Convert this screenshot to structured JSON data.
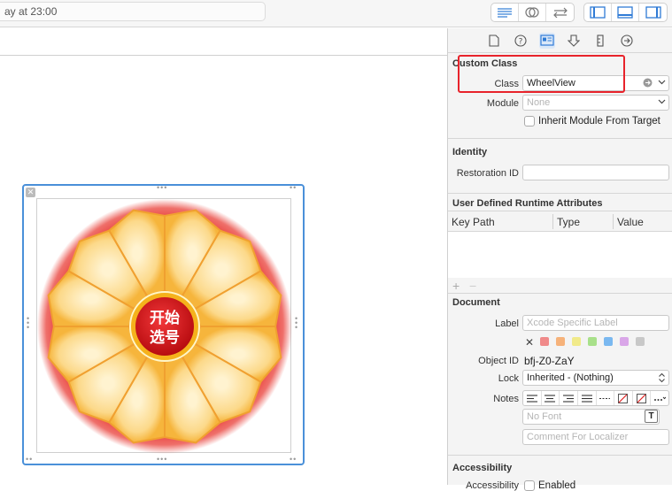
{
  "toolbar": {
    "status_text": "ay at 23:00",
    "editor_buttons": [
      "standard-editor-icon",
      "assistant-editor-icon",
      "version-editor-icon"
    ],
    "view_buttons": [
      "navigator-toggle-icon",
      "debug-area-toggle-icon",
      "utilities-toggle-icon"
    ]
  },
  "canvas": {
    "view_name": "WheelView",
    "center_button": {
      "line1": "开始",
      "line2": "选号"
    },
    "colors": {
      "selection": "#4a90d9",
      "wheel_outer": "#e8322b",
      "wheel_petal": "#fcd98a",
      "center_red": "#d8141a",
      "center_ring": "#f5b21c"
    }
  },
  "inspector": {
    "tabs": [
      "file-icon",
      "help-icon",
      "identity-icon",
      "attributes-icon",
      "size-icon",
      "connections-icon"
    ],
    "custom_class": {
      "title": "Custom Class",
      "class_label": "Class",
      "class_value": "WheelView",
      "module_label": "Module",
      "module_placeholder": "None",
      "inherit_label": "Inherit Module From Target"
    },
    "identity": {
      "title": "Identity",
      "restoration_label": "Restoration ID",
      "restoration_value": ""
    },
    "runtime_attributes": {
      "title": "User Defined Runtime Attributes",
      "columns": [
        "Key Path",
        "Type",
        "Value"
      ],
      "add_label": "+",
      "remove_label": "−"
    },
    "document": {
      "title": "Document",
      "label_label": "Label",
      "label_placeholder": "Xcode Specific Label",
      "object_id_label": "Object ID",
      "object_id_value": "bfj-Z0-ZaY",
      "lock_label": "Lock",
      "lock_value": "Inherited - (Nothing)",
      "notes_label": "Notes",
      "font_placeholder": "No Font",
      "comment_placeholder": "Comment For Localizer",
      "swatch_colors": [
        "#f08a8a",
        "#f6b27a",
        "#f1ea8a",
        "#a8e08a",
        "#7ab8f0",
        "#d9a6e8",
        "#c8c8c8"
      ]
    },
    "accessibility": {
      "title": "Accessibility",
      "partial_label": "Accessibility",
      "enabled_label": "Enabled"
    }
  }
}
